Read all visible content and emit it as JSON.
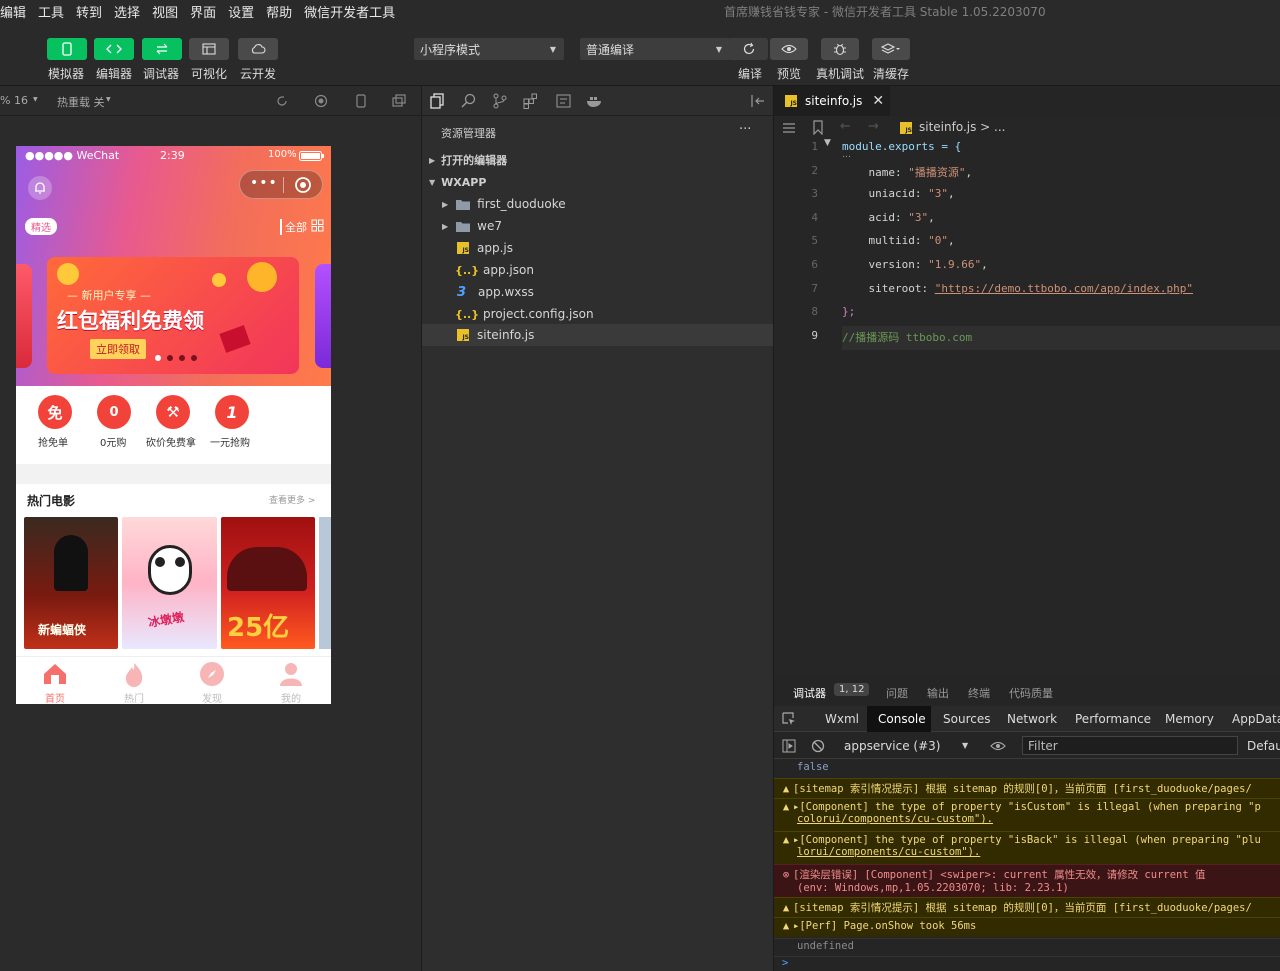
{
  "menu": {
    "items": [
      "编辑",
      "工具",
      "转到",
      "选择",
      "视图",
      "界面",
      "设置",
      "帮助",
      "微信开发者工具"
    ]
  },
  "window_title": "首席赚钱省钱专家 - 微信开发者工具 Stable 1.05.2203070",
  "toolbar": {
    "left_buttons": [
      {
        "label": "模拟器",
        "icon": "phone-icon"
      },
      {
        "label": "编辑器",
        "icon": "code-icon"
      },
      {
        "label": "调试器",
        "icon": "debug-icon"
      },
      {
        "label": "可视化",
        "icon": "layout-icon"
      },
      {
        "label": "云开发",
        "icon": "cloud-icon"
      }
    ],
    "mode_select": "小程序模式",
    "compile_select": "普通编译",
    "right_buttons": [
      {
        "label": "编译",
        "icon": "refresh-icon"
      },
      {
        "label": "预览",
        "icon": "eye-icon"
      },
      {
        "label": "真机调试",
        "icon": "bug-icon"
      },
      {
        "label": "清缓存",
        "icon": "layers-icon"
      }
    ]
  },
  "simbar": {
    "zoom": "% 16",
    "hot_reload": "热重载 关"
  },
  "phone": {
    "status": {
      "carrier": "●●●●● WeChat",
      "time": "2:39",
      "battery": "100%"
    },
    "tag": "精选",
    "all": "全部",
    "banner": {
      "subtitle": "— 新用户专享 —",
      "title": "红包福利免费领",
      "button": "立即领取"
    },
    "quick": [
      {
        "glyph": "免",
        "label": "抢免单"
      },
      {
        "glyph": "0",
        "label": "0元购"
      },
      {
        "glyph": "⚒",
        "label": "砍价免费拿"
      },
      {
        "glyph": "1",
        "label": "一元抢购"
      }
    ],
    "section": {
      "title": "热门电影",
      "more": "查看更多 >"
    },
    "posters": [
      {
        "caption": "新蝙蝠侠"
      },
      {
        "caption": "冰墩墩"
      },
      {
        "caption": "25亿"
      }
    ],
    "tabs": [
      {
        "label": "首页"
      },
      {
        "label": "热门"
      },
      {
        "label": "发现"
      },
      {
        "label": "我的"
      }
    ]
  },
  "explorer": {
    "title": "资源管理器",
    "more": "···",
    "open_editors": "打开的编辑器",
    "root": "WXAPP",
    "items": [
      {
        "name": "first_duoduoke",
        "kind": "folder"
      },
      {
        "name": "we7",
        "kind": "folder"
      },
      {
        "name": "app.js",
        "kind": "js"
      },
      {
        "name": "app.json",
        "kind": "json"
      },
      {
        "name": "app.wxss",
        "kind": "css"
      },
      {
        "name": "project.config.json",
        "kind": "json"
      },
      {
        "name": "siteinfo.js",
        "kind": "js"
      }
    ]
  },
  "editor": {
    "tab": "siteinfo.js",
    "breadcrumb": "siteinfo.js > ...",
    "lines": [
      {
        "n": "1",
        "parts": [
          [
            "module.exports = {",
            "#9cdcfe"
          ]
        ]
      },
      {
        "n": "2",
        "parts": [
          [
            "    name: ",
            "#d4d4d4"
          ],
          [
            "\"播播资源\"",
            "#ce9178"
          ],
          [
            ",",
            "#d4d4d4"
          ]
        ]
      },
      {
        "n": "3",
        "parts": [
          [
            "    uniacid: ",
            "#d4d4d4"
          ],
          [
            "\"3\"",
            "#ce9178"
          ],
          [
            ",",
            "#d4d4d4"
          ]
        ]
      },
      {
        "n": "4",
        "parts": [
          [
            "    acid: ",
            "#d4d4d4"
          ],
          [
            "\"3\"",
            "#ce9178"
          ],
          [
            ",",
            "#d4d4d4"
          ]
        ]
      },
      {
        "n": "5",
        "parts": [
          [
            "    multiid: ",
            "#d4d4d4"
          ],
          [
            "\"0\"",
            "#ce9178"
          ],
          [
            ",",
            "#d4d4d4"
          ]
        ]
      },
      {
        "n": "6",
        "parts": [
          [
            "    version: ",
            "#d4d4d4"
          ],
          [
            "\"1.9.66\"",
            "#ce9178"
          ],
          [
            ",",
            "#d4d4d4"
          ]
        ]
      },
      {
        "n": "7",
        "parts": [
          [
            "    siteroot: ",
            "#d4d4d4"
          ],
          [
            "\"https://demo.ttbobo.com/app/index.php\"",
            "#ce9178"
          ]
        ]
      },
      {
        "n": "8",
        "parts": [
          [
            "};",
            "#c586c0"
          ]
        ]
      },
      {
        "n": "9",
        "parts": [
          [
            "//播播源码 ttbobo.com",
            "#6a9955"
          ]
        ]
      }
    ]
  },
  "console": {
    "tabs": [
      "调试器",
      "1, 12",
      "问题",
      "输出",
      "终端",
      "代码质量"
    ],
    "devtabs": [
      "Wxml",
      "Console",
      "Sources",
      "Network",
      "Performance",
      "Memory",
      "AppData"
    ],
    "context": "appservice (#3)",
    "filter": "Filter",
    "levels": "Defaul",
    "lines": [
      {
        "type": "plain",
        "text": "false"
      },
      {
        "type": "warn",
        "text": "[sitemap 索引情况提示] 根据 sitemap 的规则[0]，当前页面 [first_duoduoke/pages/"
      },
      {
        "type": "warn",
        "text": "▸[Component] the type of property \"isCustom\" is illegal (when preparing \"p",
        "text2": "colorui/components/cu-custom\")."
      },
      {
        "type": "warn",
        "text": "▸[Component] the type of property \"isBack\" is illegal (when preparing \"plu",
        "text2": "lorui/components/cu-custom\")."
      },
      {
        "type": "err",
        "text": "[渲染层错误] [Component] <swiper>: current 属性无效，请修改 current 值",
        "text2": "(env: Windows,mp,1.05.2203070; lib: 2.23.1)"
      },
      {
        "type": "warn",
        "text": "[sitemap 索引情况提示] 根据 sitemap 的规则[0]，当前页面 [first_duoduoke/pages/"
      },
      {
        "type": "warn",
        "text": "▸[Perf] Page.onShow took 56ms"
      },
      {
        "type": "plain",
        "text": "undefined"
      }
    ],
    "prompt": ">"
  }
}
